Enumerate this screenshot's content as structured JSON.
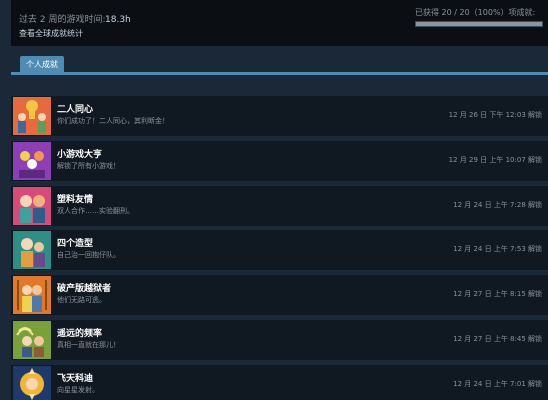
{
  "stats": {
    "playtime_label": "过去 2 周的游戏时间:",
    "playtime_value": "18.3h",
    "global_link": "查看全球成就统计",
    "progress_label": "已获得 20 / 20（100%）项成就:",
    "progress_fraction": 1.0
  },
  "tabs": {
    "personal": "个人成就"
  },
  "achievements": [
    {
      "title": "二人同心",
      "desc": "你们成功了！二人同心，其利断金！",
      "date": "12 月 26 日 下午 12:03 解锁",
      "icon": "trophy-couple-icon"
    },
    {
      "title": "小游戏大亨",
      "desc": "解锁了所有小游戏！",
      "date": "12 月 29 日 上午 10:07 解锁",
      "icon": "minigame-crowd-icon"
    },
    {
      "title": "塑料友情",
      "desc": "双人合作……实验翻刑。",
      "date": "12 月 24 日 上午 7:28 解锁",
      "icon": "plastic-friends-icon"
    },
    {
      "title": "四个造型",
      "desc": "自己治一回抱仔队。",
      "date": "12 月 24 日 上午 7:53 解锁",
      "icon": "four-looks-icon"
    },
    {
      "title": "破产版越狱者",
      "desc": "他们无路可逃。",
      "date": "12 月 27 日 上午 8:15 解锁",
      "icon": "prison-escape-icon"
    },
    {
      "title": "遥远的频率",
      "desc": "真相一直就在那儿！",
      "date": "12 月 27 日 上午 8:45 解锁",
      "icon": "distant-frequency-icon"
    },
    {
      "title": "飞天科迪",
      "desc": "向星星发射。",
      "date": "12 月 24 日 上午 7:01 解锁",
      "icon": "flying-cody-icon"
    }
  ],
  "colors": {
    "background": "#1b2838",
    "row": "#101822",
    "accent": "#4e8cb3"
  }
}
